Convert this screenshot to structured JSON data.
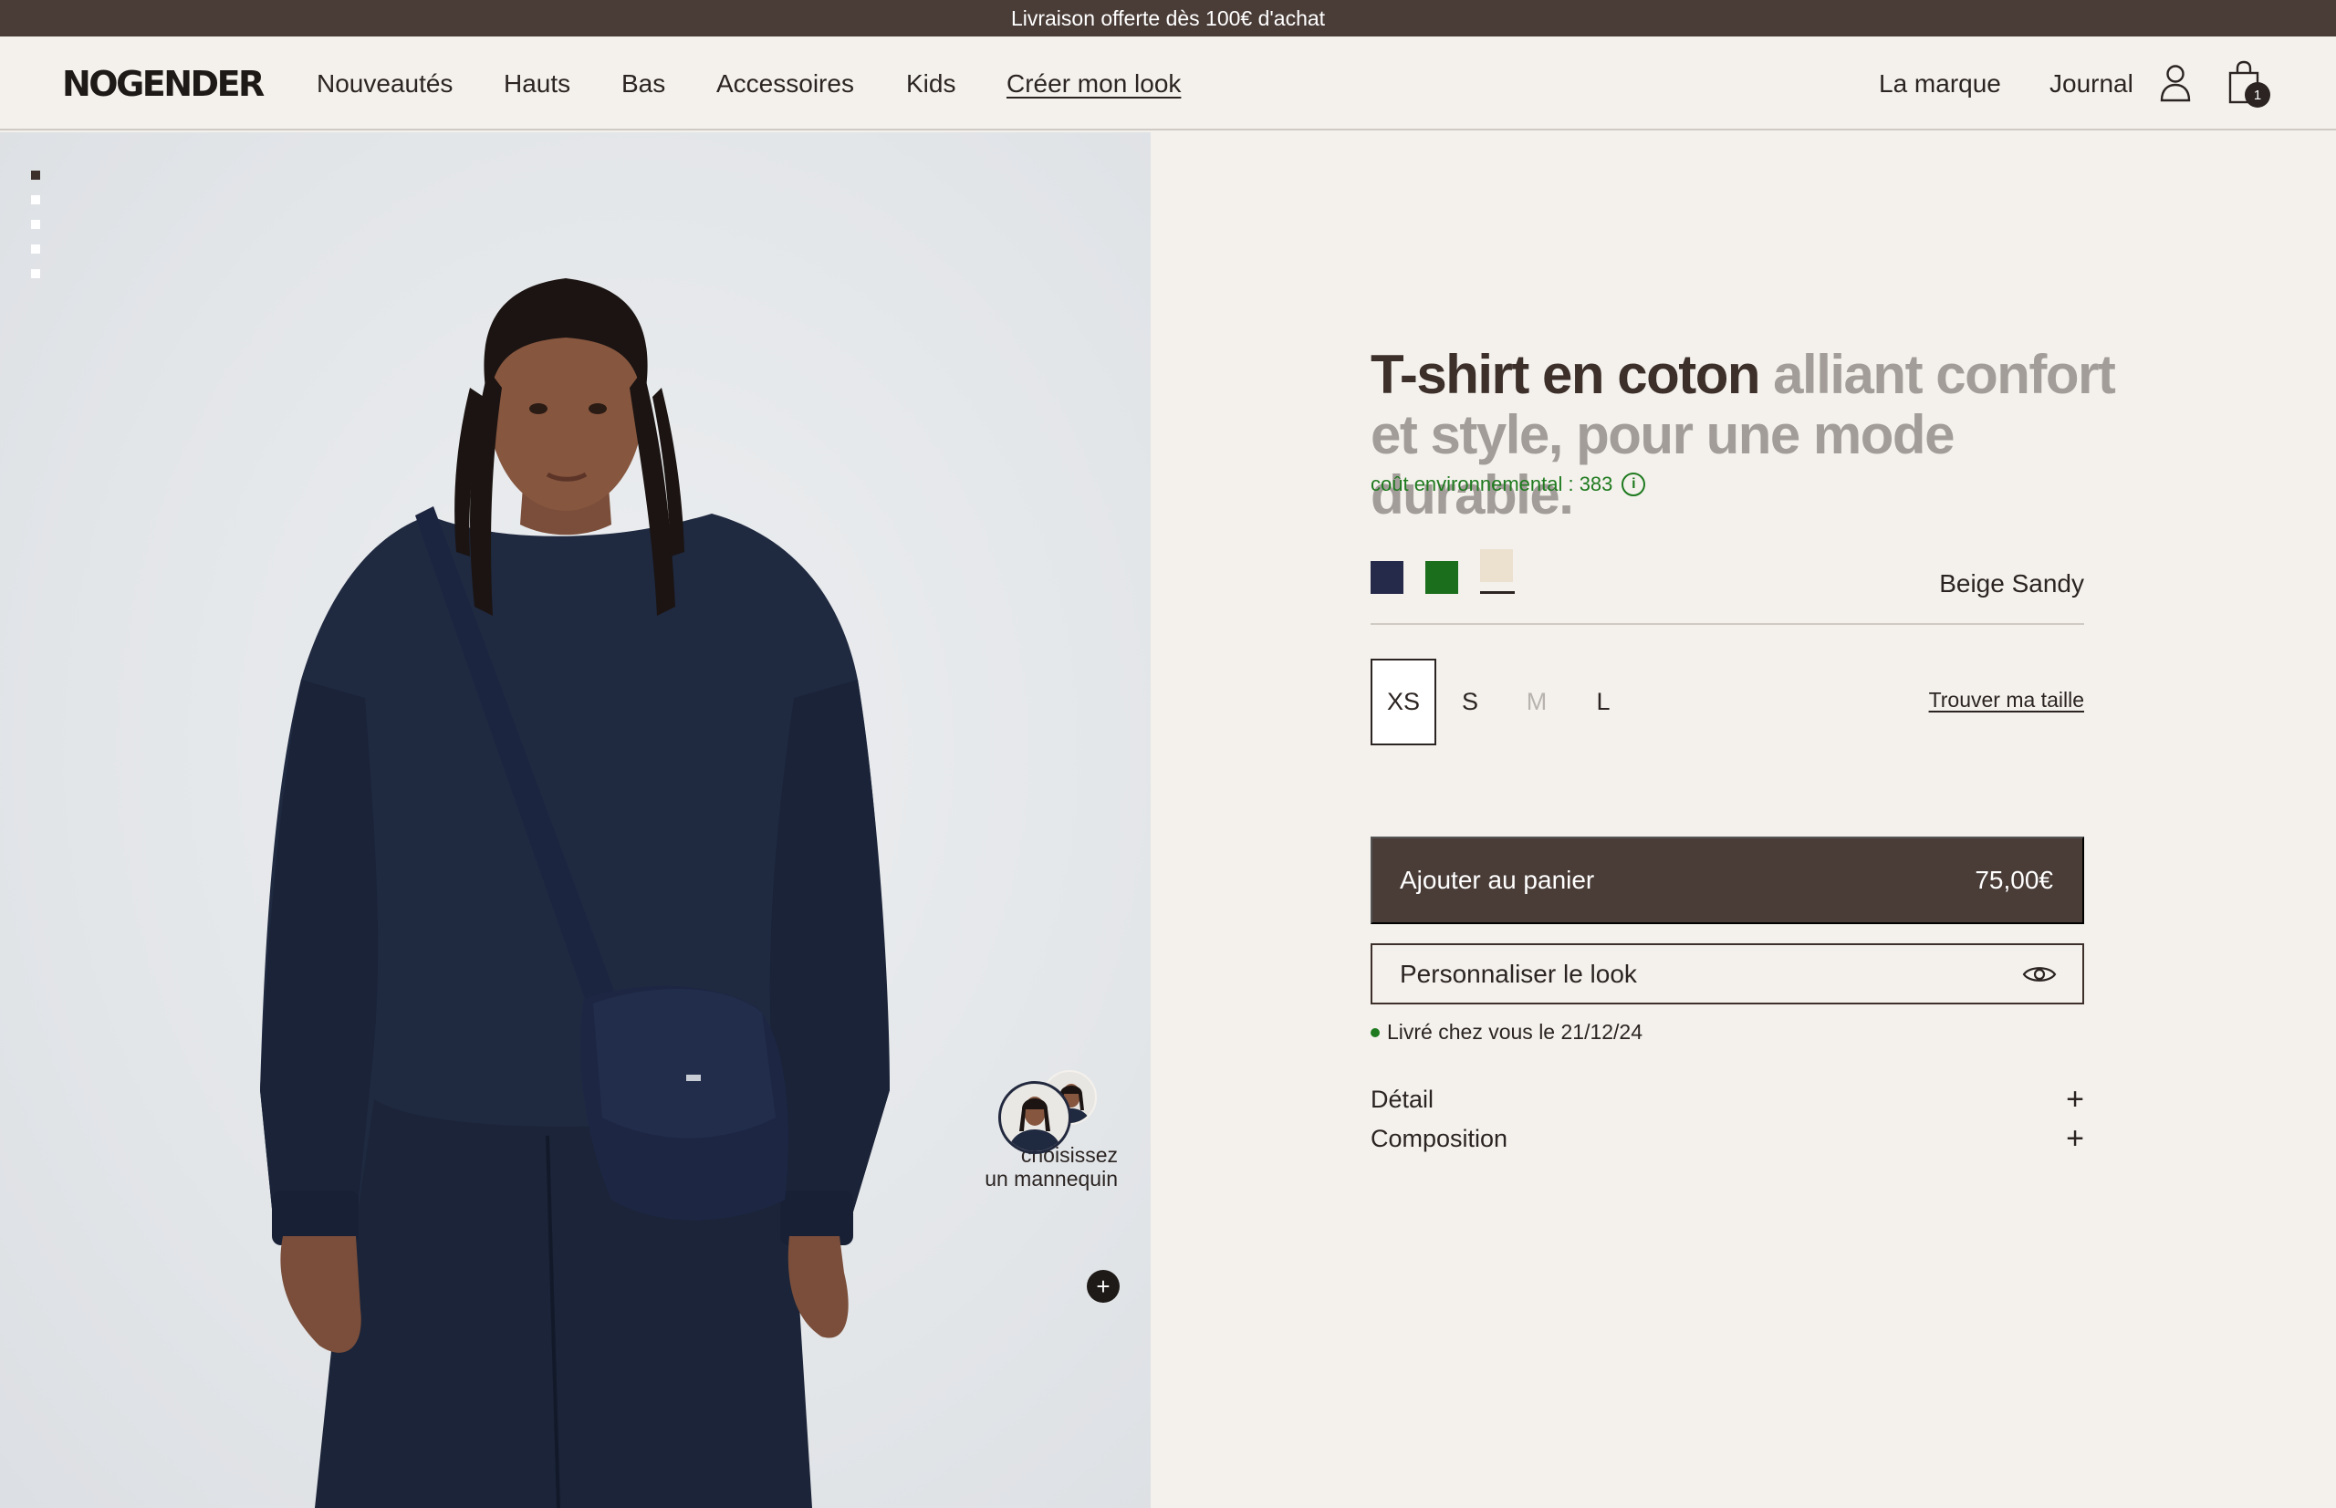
{
  "announcement": "Livraison offerte dès 100€ d'achat",
  "header": {
    "logo": "NOGENDER",
    "nav": [
      "Nouveautés",
      "Hauts",
      "Bas",
      "Accessoires",
      "Kids",
      "Créer mon look"
    ],
    "nav_right": [
      "La marque",
      "Journal"
    ],
    "cart_count": "1"
  },
  "gallery": {
    "image_count": 5,
    "active_index": 0,
    "mannequin_label_line1": "choisissez",
    "mannequin_label_line2": "un mannequin",
    "add_symbol": "+"
  },
  "product": {
    "title_strong": "T-shirt en coton",
    "title_rest": " alliant confort et style, pour une mode durable.",
    "eco_label": "coût environnemental : 383",
    "colors": [
      {
        "name": "Bleu marine",
        "hex": "#252a4a"
      },
      {
        "name": "Vert",
        "hex": "#1b6e1b"
      },
      {
        "name": "Beige Sandy",
        "hex": "#ece0cf"
      }
    ],
    "selected_color": "Beige Sandy",
    "sizes": [
      "XS",
      "S",
      "M",
      "L"
    ],
    "selected_size": "XS",
    "unavailable_sizes": [
      "M"
    ],
    "find_size": "Trouver ma taille",
    "add_to_cart": "Ajouter au panier",
    "price": "75,00€",
    "personalize": "Personnaliser le look",
    "delivery": "Livré chez vous le 21/12/24",
    "accordions": [
      "Détail",
      "Composition"
    ]
  },
  "colors": {
    "primary_brown": "#4a3d38",
    "background": "#f4f1ec",
    "eco_green": "#1f7a1f"
  }
}
